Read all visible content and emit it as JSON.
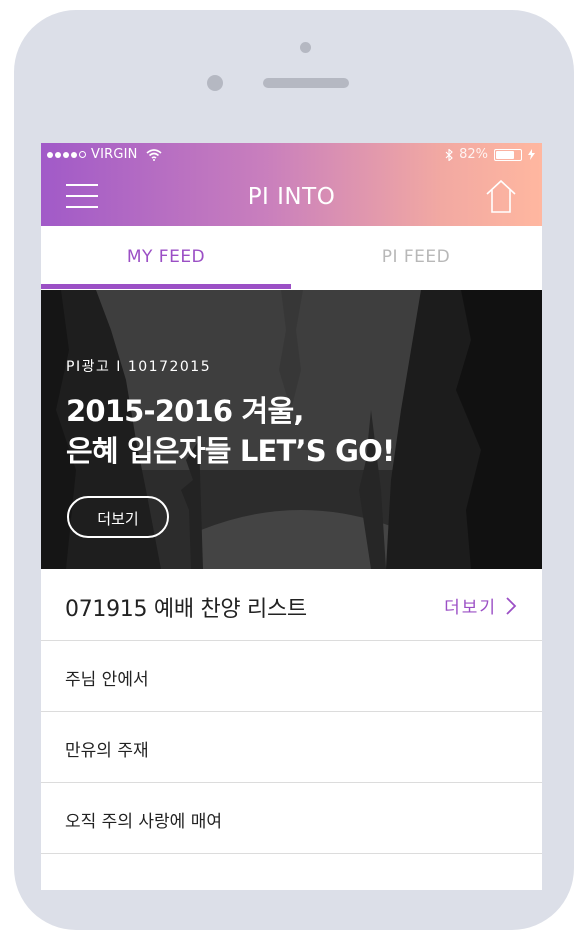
{
  "status_bar": {
    "carrier": "VIRGIN",
    "battery": "82%",
    "battery_level": 0.82
  },
  "header": {
    "title": "PI INTO",
    "menu_icon": "hamburger-menu-icon",
    "home_icon": "home-icon"
  },
  "tabs": [
    {
      "label": "MY FEED",
      "active": true
    },
    {
      "label": "PI FEED",
      "active": false
    }
  ],
  "banner": {
    "caption": "PI광고 I 10172015",
    "title_line1": "2015-2016 겨울,",
    "title_line2": "은혜 입은자들 LET’S GO!",
    "more_label": "더보기"
  },
  "list": {
    "title": "071915 예배 찬양 리스트",
    "more_label": "더보기",
    "items": [
      {
        "label": "주님 안에서"
      },
      {
        "label": "만유의 주재"
      },
      {
        "label": "오직 주의 사랑에 매여"
      }
    ]
  },
  "colors": {
    "accent": "#9b4fc5",
    "header_gradient_start": "#a15ac8",
    "header_gradient_end": "#ffb7a0",
    "device_frame": "#dcdfe8"
  }
}
